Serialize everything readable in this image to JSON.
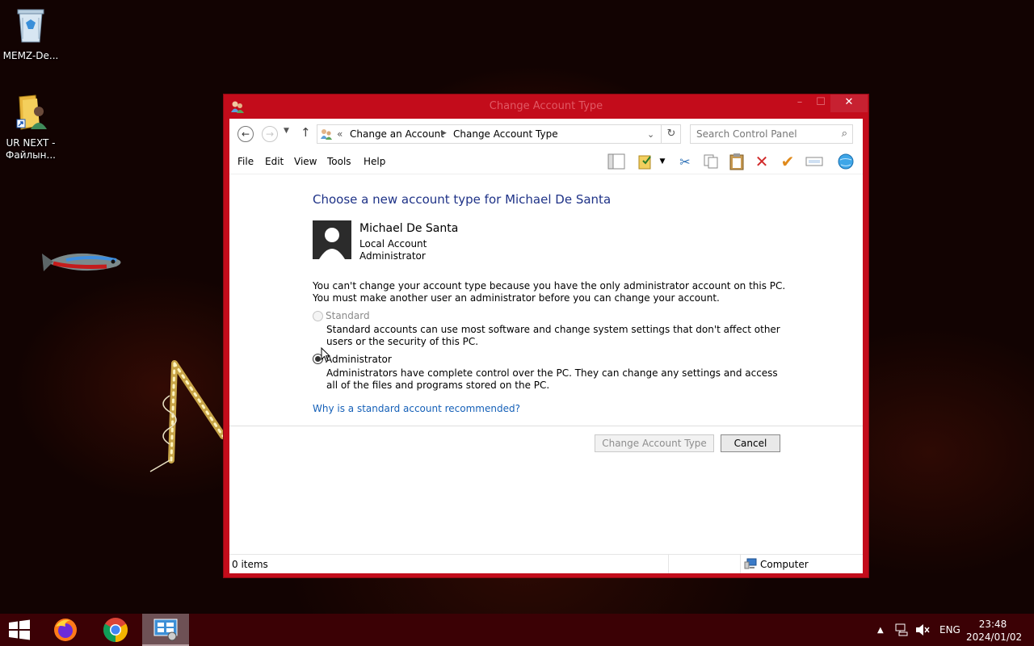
{
  "desktop": {
    "icons": [
      {
        "label": "MEMZ-De...",
        "icon": "recycle-bin-icon"
      },
      {
        "label": "UR NEXT - Файлын...",
        "icon": "folder-shortcut-icon"
      }
    ]
  },
  "window": {
    "title": "Change Account Type",
    "controls": {
      "minimize": "–",
      "maximize": "☐",
      "close": "✕"
    },
    "accent_color": "#c30c1b",
    "address": {
      "overflow": "«",
      "crumbs": [
        "Change an Account",
        "Change Account Type"
      ]
    },
    "search": {
      "placeholder": "Search Control Panel"
    },
    "menu": [
      "File",
      "Edit",
      "View",
      "Tools",
      "Help"
    ],
    "toolbar_icons": [
      "preview-pane-icon",
      "folder-check-icon",
      "dropdown-icon",
      "cut-icon",
      "copy-icon",
      "paste-icon",
      "delete-icon",
      "checkmark-icon",
      "rename-icon",
      "globe-icon"
    ],
    "content": {
      "heading": "Choose a new account type for Michael De Santa",
      "user": {
        "name": "Michael De Santa",
        "account_kind": "Local Account",
        "role": "Administrator"
      },
      "note": "You can't change your account type because you have the only administrator account on this PC. You must make another user an administrator before you can change your account.",
      "options": [
        {
          "label": "Standard",
          "description": "Standard accounts can use most software and change system settings that don't affect other users or the security of this PC.",
          "selected": false,
          "disabled": true
        },
        {
          "label": "Administrator",
          "description": "Administrators have complete control over the PC. They can change any settings and access all of the files and programs stored on the PC.",
          "selected": true,
          "disabled": false
        }
      ],
      "help_link": "Why is a standard account recommended?",
      "buttons": {
        "change": "Change Account Type",
        "cancel": "Cancel"
      }
    },
    "status": {
      "count": "0 items",
      "zone": "Computer"
    }
  },
  "taskbar": {
    "apps": [
      "start-icon",
      "firefox-icon",
      "chrome-icon",
      "control-panel-icon"
    ],
    "tray": {
      "chevron": "▲",
      "language": "ENG"
    },
    "clock": {
      "time": "23:48",
      "date": "2024/01/02"
    }
  }
}
